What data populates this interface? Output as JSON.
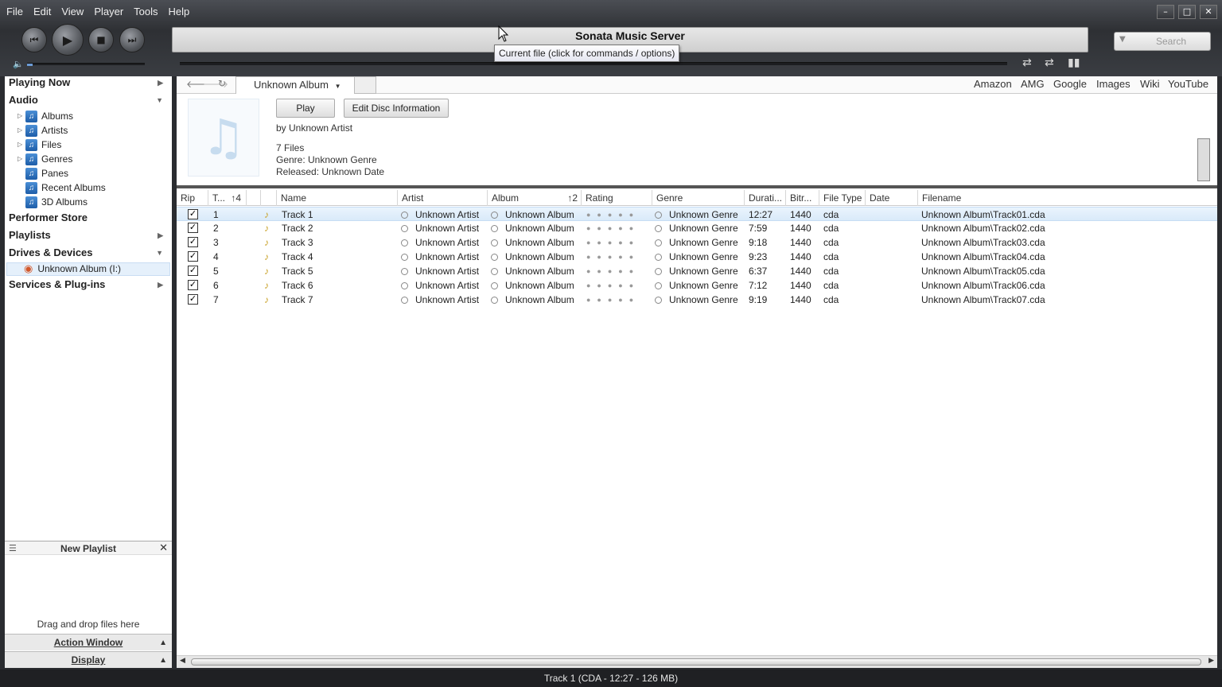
{
  "menu": [
    "File",
    "Edit",
    "View",
    "Player",
    "Tools",
    "Help"
  ],
  "player": {
    "display_title": "Sonata Music Server",
    "tooltip": "Current file (click for commands / options)",
    "search_placeholder": "Search",
    "volume_level": 0.05
  },
  "sidebar": {
    "playing_now": "Playing Now",
    "audio": "Audio",
    "audio_items": [
      "Albums",
      "Artists",
      "Files",
      "Genres",
      "Panes",
      "Recent Albums",
      "3D Albums"
    ],
    "performer_store": "Performer Store",
    "playlists": "Playlists",
    "drives_devices": "Drives & Devices",
    "drive_item": "Unknown Album (I:)",
    "services": "Services & Plug-ins",
    "new_playlist": "New Playlist",
    "drag_text": "Drag and drop files here",
    "action_window": "Action Window",
    "display": "Display"
  },
  "main": {
    "tab_label": "Unknown Album",
    "links": [
      "Amazon",
      "AMG",
      "Google",
      "Images",
      "Wiki",
      "YouTube"
    ],
    "play_button": "Play",
    "edit_disc_button": "Edit Disc Information",
    "by_artist": "by Unknown Artist",
    "files_count": "7 Files",
    "genre": "Genre: Unknown Genre",
    "released": "Released: Unknown Date"
  },
  "columns": [
    "Rip",
    "T...",
    "4",
    "Name",
    "Artist",
    "Album",
    "2",
    "Rating",
    "Genre",
    "Durati...",
    "Bitr...",
    "File Type",
    "Date",
    "Filename"
  ],
  "tracks": [
    {
      "n": "1",
      "name": "Track 1",
      "artist": "Unknown Artist",
      "album": "Unknown Album",
      "genre": "Unknown Genre",
      "duration": "12:27",
      "bitrate": "1440",
      "type": "cda",
      "filename": "Unknown Album\\Track01.cda"
    },
    {
      "n": "2",
      "name": "Track 2",
      "artist": "Unknown Artist",
      "album": "Unknown Album",
      "genre": "Unknown Genre",
      "duration": "7:59",
      "bitrate": "1440",
      "type": "cda",
      "filename": "Unknown Album\\Track02.cda"
    },
    {
      "n": "3",
      "name": "Track 3",
      "artist": "Unknown Artist",
      "album": "Unknown Album",
      "genre": "Unknown Genre",
      "duration": "9:18",
      "bitrate": "1440",
      "type": "cda",
      "filename": "Unknown Album\\Track03.cda"
    },
    {
      "n": "4",
      "name": "Track 4",
      "artist": "Unknown Artist",
      "album": "Unknown Album",
      "genre": "Unknown Genre",
      "duration": "9:23",
      "bitrate": "1440",
      "type": "cda",
      "filename": "Unknown Album\\Track04.cda"
    },
    {
      "n": "5",
      "name": "Track 5",
      "artist": "Unknown Artist",
      "album": "Unknown Album",
      "genre": "Unknown Genre",
      "duration": "6:37",
      "bitrate": "1440",
      "type": "cda",
      "filename": "Unknown Album\\Track05.cda"
    },
    {
      "n": "6",
      "name": "Track 6",
      "artist": "Unknown Artist",
      "album": "Unknown Album",
      "genre": "Unknown Genre",
      "duration": "7:12",
      "bitrate": "1440",
      "type": "cda",
      "filename": "Unknown Album\\Track06.cda"
    },
    {
      "n": "7",
      "name": "Track 7",
      "artist": "Unknown Artist",
      "album": "Unknown Album",
      "genre": "Unknown Genre",
      "duration": "9:19",
      "bitrate": "1440",
      "type": "cda",
      "filename": "Unknown Album\\Track07.cda"
    }
  ],
  "status": "Track 1 (CDA - 12:27 - 126 MB)"
}
